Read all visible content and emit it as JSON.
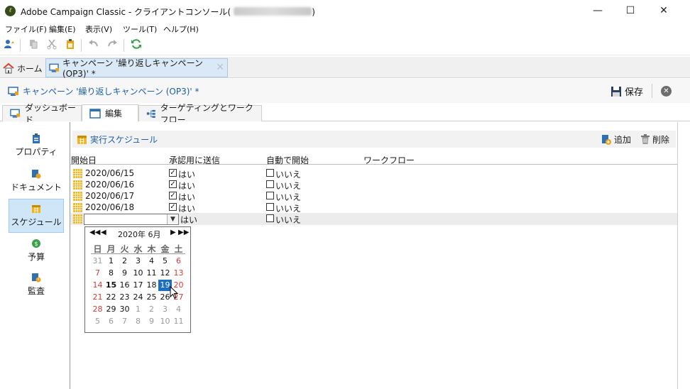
{
  "window": {
    "title": "Adobe Campaign Classic - クライアントコンソール",
    "controls": [
      "—",
      "☐",
      "✕"
    ]
  },
  "menu": [
    "ファイル(F)",
    "編集(E)",
    "表示(V)",
    "ツール(T)",
    "ヘルプ(H)"
  ],
  "tabs": {
    "home": "ホーム",
    "campaign": "キャンペーン '繰り返しキャンペーン (OP3)' *"
  },
  "header": {
    "title": "キャンペーン '繰り返しキャンペーン (OP3)' *",
    "save": "保存"
  },
  "view_tabs": [
    "ダッシュボード",
    "編集",
    "ターゲティングとワークフロー"
  ],
  "sidebar": [
    "プロパティ",
    "ドキュメント",
    "スケジュール",
    "予算",
    "監査"
  ],
  "section": {
    "title": "実行スケジュール",
    "add": "追加",
    "delete": "削除"
  },
  "table": {
    "headers": [
      "開始日",
      "承認用に送信",
      "自動で開始",
      "ワークフロー"
    ],
    "rows": [
      {
        "date": "2020/06/15",
        "approval": "はい",
        "auto": "いいえ"
      },
      {
        "date": "2020/06/16",
        "approval": "はい",
        "auto": "いいえ"
      },
      {
        "date": "2020/06/17",
        "approval": "はい",
        "auto": "いいえ"
      },
      {
        "date": "2020/06/18",
        "approval": "はい",
        "auto": "いいえ"
      },
      {
        "date": "",
        "approval": "はい",
        "auto": "いいえ"
      }
    ]
  },
  "calendar": {
    "month_label": "2020年 6月",
    "weekdays": [
      "日",
      "月",
      "火",
      "水",
      "木",
      "金",
      "土"
    ],
    "weeks": [
      [
        "31",
        "1",
        "2",
        "3",
        "4",
        "5",
        "6"
      ],
      [
        "7",
        "8",
        "9",
        "10",
        "11",
        "12",
        "13"
      ],
      [
        "14",
        "15",
        "16",
        "17",
        "18",
        "19",
        "20"
      ],
      [
        "21",
        "22",
        "23",
        "24",
        "25",
        "26",
        "27"
      ],
      [
        "28",
        "29",
        "30",
        "1",
        "2",
        "3",
        "4"
      ],
      [
        "5",
        "6",
        "7",
        "8",
        "9",
        "10",
        "11"
      ]
    ],
    "today": "15",
    "selected": "19"
  },
  "colors": {
    "accent": "#1a5ea8",
    "selected_day": "#1c6dc4",
    "weekend": "#d63a3a",
    "calendar_icon": "#f1b41c"
  }
}
